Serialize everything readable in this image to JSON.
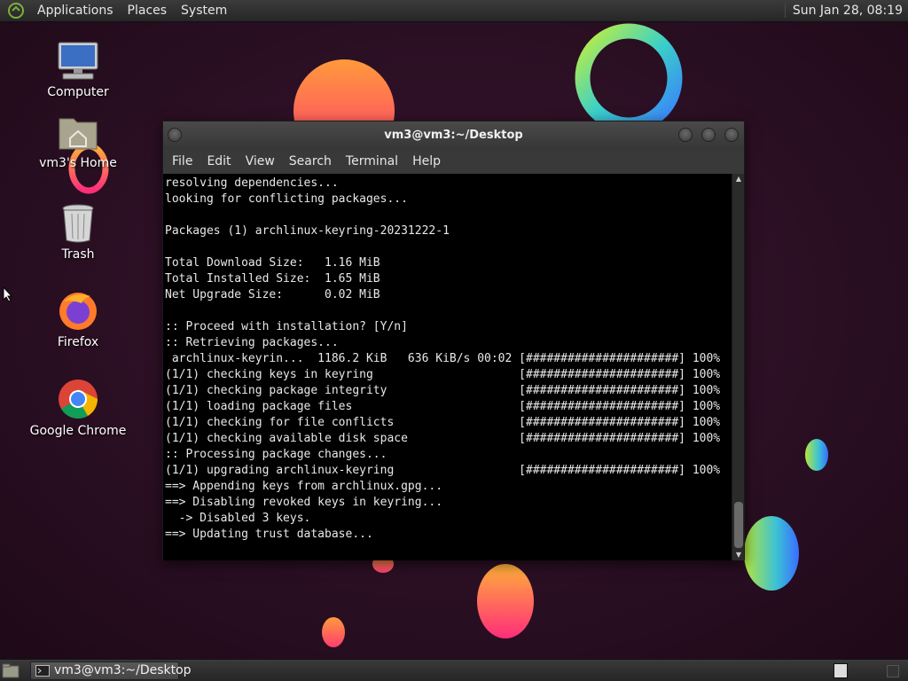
{
  "top_panel": {
    "menus": [
      "Applications",
      "Places",
      "System"
    ],
    "clock": "Sun Jan 28, 08:19",
    "logo_icon": "mate-logo-icon"
  },
  "desktop_icons": [
    {
      "label": "Computer",
      "icon": "computer-icon"
    },
    {
      "label": "vm3's Home",
      "icon": "home-folder-icon"
    },
    {
      "label": "Trash",
      "icon": "trash-icon"
    },
    {
      "label": "Firefox",
      "icon": "firefox-icon"
    },
    {
      "label": "Google Chrome",
      "icon": "chrome-icon"
    }
  ],
  "terminal": {
    "title": "vm3@vm3:~/Desktop",
    "menu": [
      "File",
      "Edit",
      "View",
      "Search",
      "Terminal",
      "Help"
    ],
    "lines": [
      "resolving dependencies...",
      "looking for conflicting packages...",
      "",
      "Packages (1) archlinux-keyring-20231222-1",
      "",
      "Total Download Size:   1.16 MiB",
      "Total Installed Size:  1.65 MiB",
      "Net Upgrade Size:      0.02 MiB",
      "",
      ":: Proceed with installation? [Y/n]",
      ":: Retrieving packages...",
      " archlinux-keyrin...  1186.2 KiB   636 KiB/s 00:02 [######################] 100%",
      "(1/1) checking keys in keyring                     [######################] 100%",
      "(1/1) checking package integrity                   [######################] 100%",
      "(1/1) loading package files                        [######################] 100%",
      "(1/1) checking for file conflicts                  [######################] 100%",
      "(1/1) checking available disk space                [######################] 100%",
      ":: Processing package changes...",
      "(1/1) upgrading archlinux-keyring                  [######################] 100%",
      "==> Appending keys from archlinux.gpg...",
      "==> Disabling revoked keys in keyring...",
      "  -> Disabled 3 keys.",
      "==> Updating trust database..."
    ]
  },
  "bottom_panel": {
    "taskbar_item": "vm3@vm3:~/Desktop"
  },
  "colors": {
    "terminal_bg": "#000000",
    "terminal_fg": "#e8e8e8",
    "wallpaper_bg": "#2a0f22"
  }
}
